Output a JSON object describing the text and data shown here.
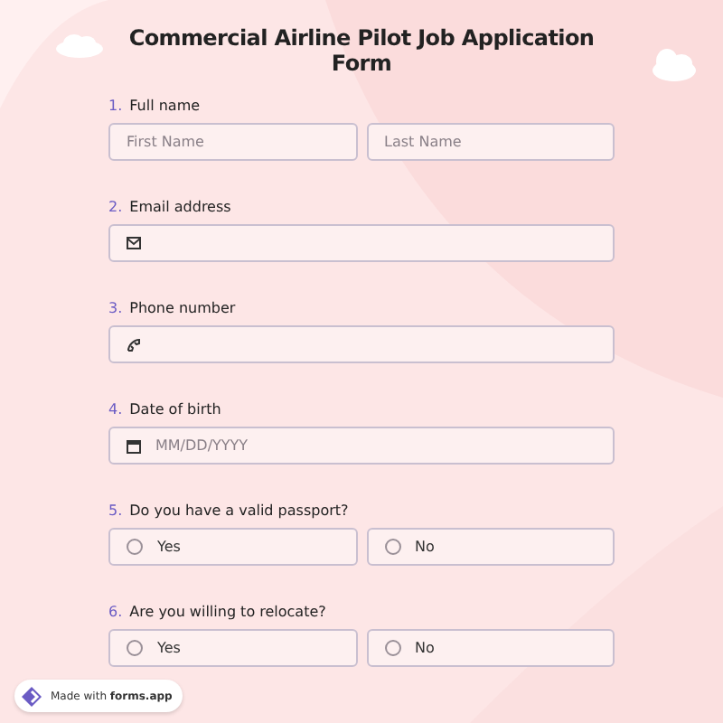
{
  "title": "Commercial Airline Pilot Job Application Form",
  "questions": [
    {
      "number": "1.",
      "label": "Full name",
      "kind": "name",
      "fields": [
        {
          "placeholder": "First Name"
        },
        {
          "placeholder": "Last Name"
        }
      ]
    },
    {
      "number": "2.",
      "label": "Email address",
      "kind": "email"
    },
    {
      "number": "3.",
      "label": "Phone number",
      "kind": "phone"
    },
    {
      "number": "4.",
      "label": "Date of birth",
      "kind": "date",
      "placeholder": "MM/DD/YYYY"
    },
    {
      "number": "5.",
      "label": "Do you have a valid passport?",
      "kind": "radio",
      "options": [
        {
          "label": "Yes",
          "selected": false
        },
        {
          "label": "No",
          "selected": false
        }
      ]
    },
    {
      "number": "6.",
      "label": "Are you willing to relocate?",
      "kind": "radio",
      "options": [
        {
          "label": "Yes",
          "selected": false
        },
        {
          "label": "No",
          "selected": false
        }
      ]
    }
  ],
  "badge": {
    "prefix": "Made with",
    "brand": "forms.app"
  }
}
